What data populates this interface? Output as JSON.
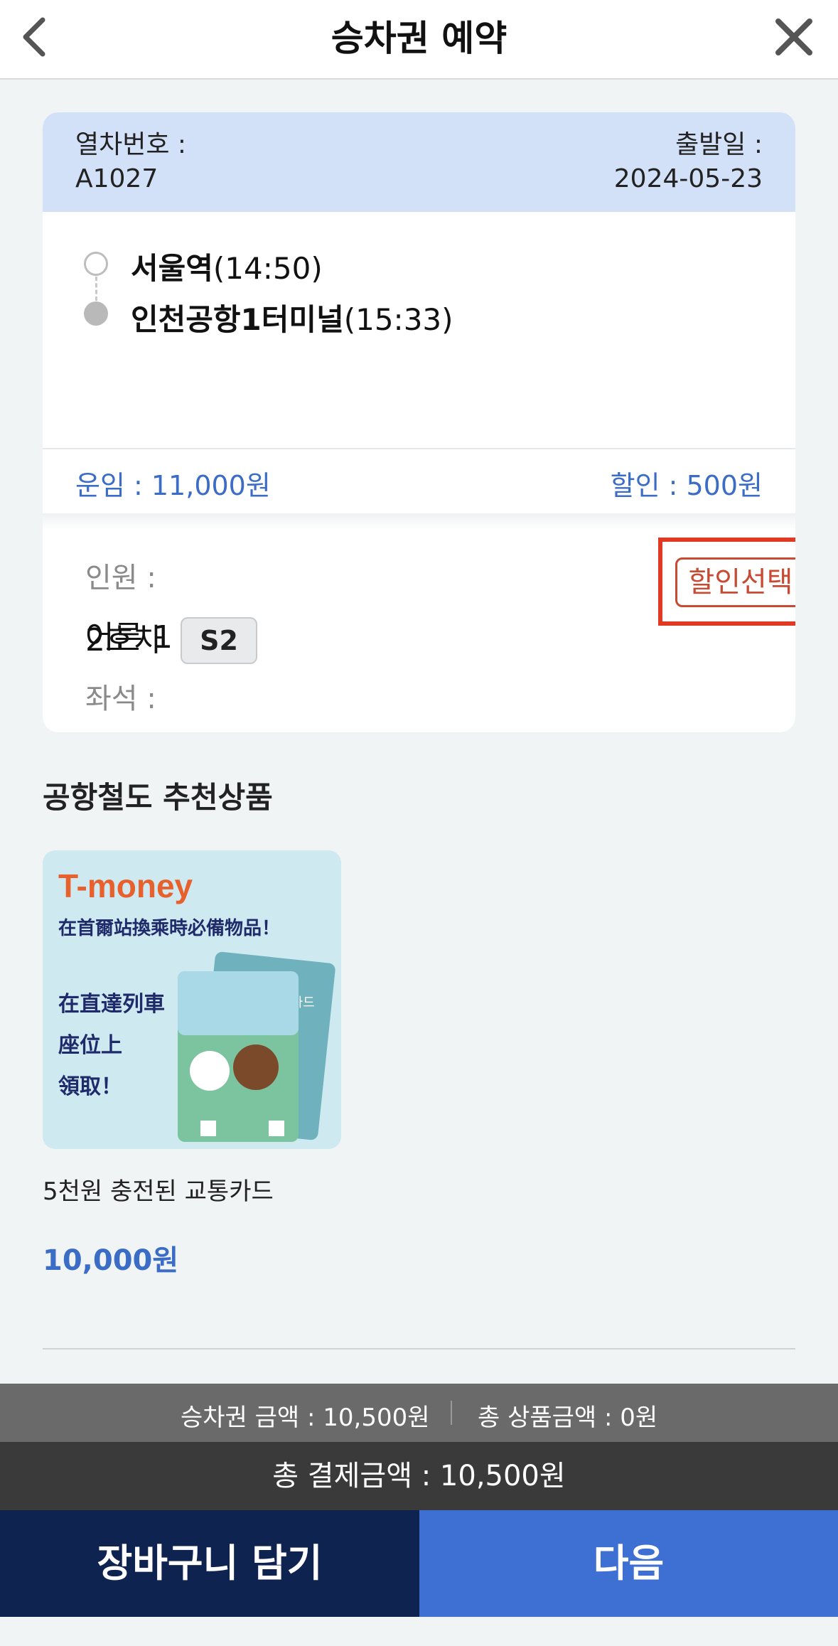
{
  "header": {
    "title": "승차권 예약",
    "back_icon": "chevron-left-icon",
    "close_icon": "close-icon"
  },
  "train": {
    "number_label": "열차번호 :",
    "number": "A1027",
    "date_label": "출발일 :",
    "date": "2024-05-23"
  },
  "route": {
    "from": {
      "station": "서울역",
      "time": "(14:50)"
    },
    "to": {
      "station": "인천공항1터미널",
      "time": "(15:33)"
    }
  },
  "fare": {
    "fare_text": "운임 : 11,000원",
    "discount_text": "할인 : 500원"
  },
  "passengers": {
    "label": "인원 :",
    "value": "어른 1",
    "discount_button": "할인선택"
  },
  "seat": {
    "label": "좌석 :",
    "car": "2호차",
    "seat_no": "S2"
  },
  "recommend": {
    "title": "공항철도 추천상품",
    "product": {
      "brand": "T-money",
      "tagline": "在首爾站換乘時必備物品！",
      "note_lines": [
        "在直達列車",
        "座位上",
        "領取！"
      ],
      "card_text": "티머니카드",
      "name": "5천원 충전된 교통카드",
      "price": "10,000원"
    }
  },
  "summary": {
    "ticket_amount": "승차권 금액 : 10,500원",
    "product_amount": "총 상품금액 : 0원",
    "total": "총 결제금액 : 10,500원"
  },
  "buttons": {
    "cart": "장바구니 담기",
    "next": "다음"
  },
  "colors": {
    "accent_blue": "#3e6fd2",
    "navy": "#0f2350",
    "header_blue": "#d2e1f8",
    "highlight_red": "#e03a22"
  }
}
